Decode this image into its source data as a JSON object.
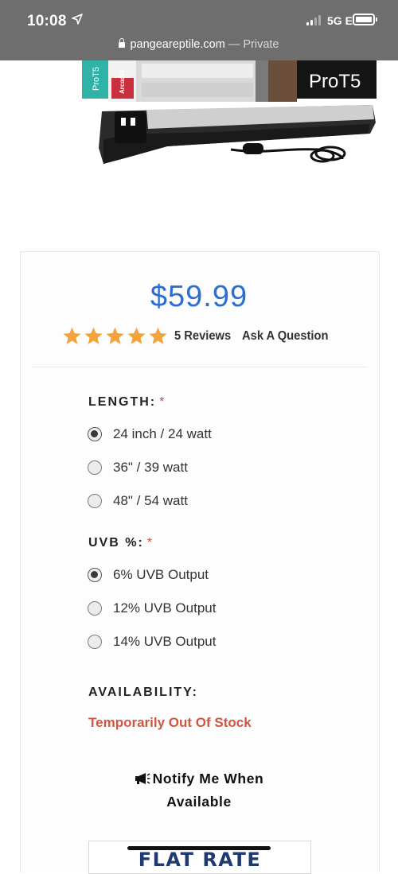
{
  "status": {
    "time": "10:08",
    "network": "5G E"
  },
  "browser": {
    "domain": "pangeareptile.com",
    "suffix": "— Private"
  },
  "product": {
    "price": "$59.99",
    "rating_stars": 5,
    "reviews_label": "5 Reviews",
    "ask_label": "Ask A Question",
    "image_text": {
      "brand": "Arcadia",
      "box_label": "ProT5",
      "kit_label": "ProT5"
    }
  },
  "length": {
    "label": "LENGTH:",
    "required": "*",
    "options": [
      "24 inch / 24 watt",
      "36\" / 39 watt",
      "48\" / 54 watt"
    ],
    "selected": 0
  },
  "uvb": {
    "label": "UVB %:",
    "required": "*",
    "options": [
      "6% UVB Output",
      "12% UVB Output",
      "14% UVB Output"
    ],
    "selected": 0
  },
  "availability": {
    "label": "AVAILABILITY:",
    "status": "Temporarily Out Of Stock",
    "status_color": "#d2553f"
  },
  "notify": {
    "line1": "Notify Me When",
    "line2": "Available"
  },
  "shipping": {
    "text": "FLAT RATE SHIPPING"
  },
  "colors": {
    "price": "#2b6ed2",
    "stars": "#f4a23a",
    "topbar": "#6e6e6e"
  }
}
